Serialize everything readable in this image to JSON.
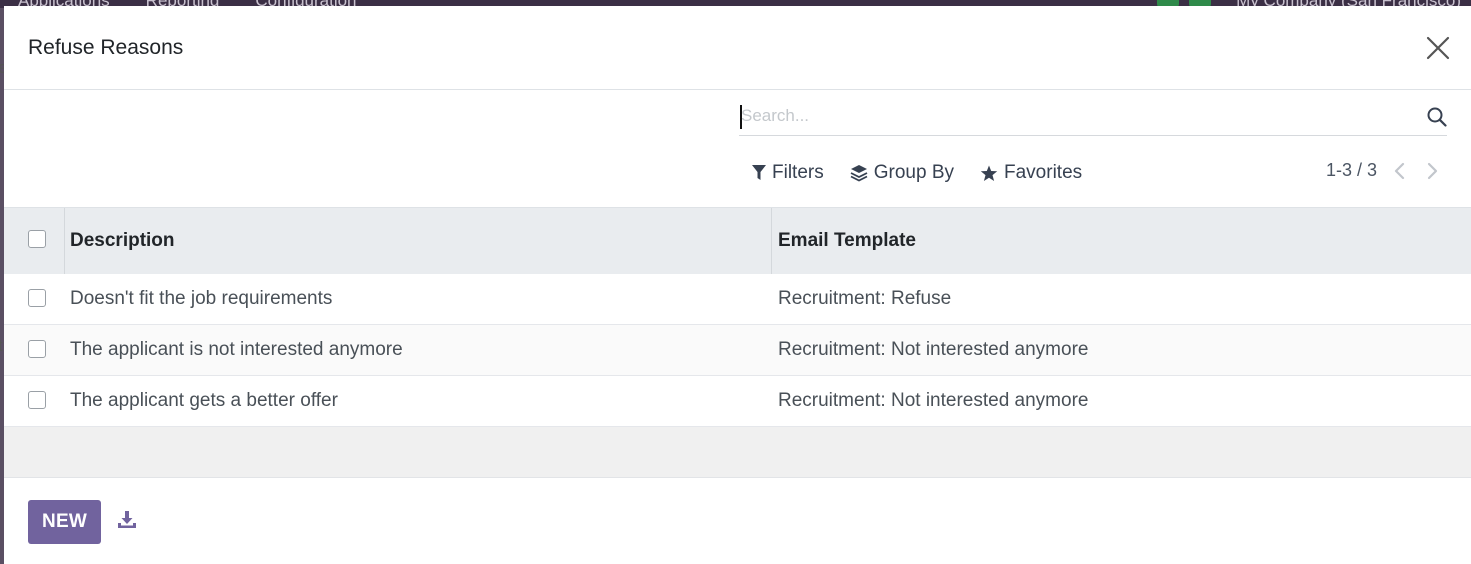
{
  "background": {
    "menu": [
      "Applications",
      "Reporting",
      "Configuration"
    ],
    "company": "My Company (San Francisco)"
  },
  "modal": {
    "title": "Refuse Reasons",
    "close_icon": "close-icon"
  },
  "search": {
    "placeholder": "Search...",
    "value": "",
    "icon": "search-icon"
  },
  "filters": {
    "filters_label": "Filters",
    "group_by_label": "Group By",
    "favorites_label": "Favorites"
  },
  "pager": {
    "text": "1-3 / 3",
    "prev_icon": "chevron-left-icon",
    "next_icon": "chevron-right-icon"
  },
  "table": {
    "columns": [
      "Description",
      "Email Template"
    ],
    "rows": [
      {
        "description": "Doesn't fit the job requirements",
        "email_template": "Recruitment: Refuse"
      },
      {
        "description": "The applicant is not interested anymore",
        "email_template": "Recruitment: Not interested anymore"
      },
      {
        "description": "The applicant gets a better offer",
        "email_template": "Recruitment: Not interested anymore"
      }
    ]
  },
  "footer": {
    "new_label": "NEW",
    "download_icon": "download-icon"
  },
  "colors": {
    "primary": "#71639e",
    "header_bg": "#e9ecef",
    "backdrop": "#5a4f63"
  }
}
